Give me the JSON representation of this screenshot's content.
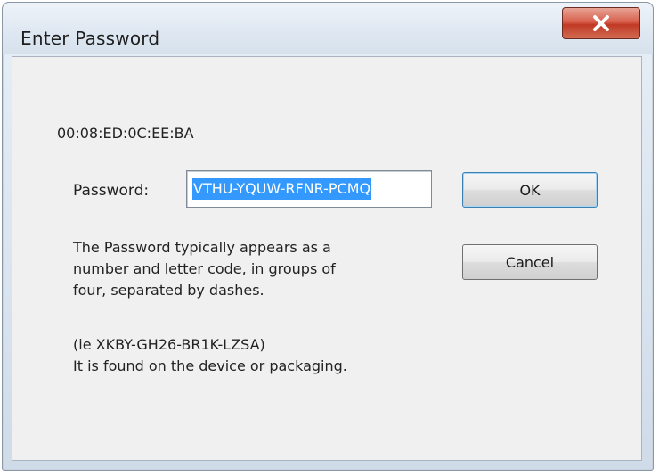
{
  "window": {
    "title": "Enter Password"
  },
  "dialog": {
    "mac_address": "00:08:ED:0C:EE:BA",
    "password_label": "Password:",
    "password_value": "VTHU-YQUW-RFNR-PCMQ",
    "ok_label": "OK",
    "cancel_label": "Cancel",
    "help_lines": [
      "The Password typically appears as a",
      "number and letter code, in groups of",
      "four, separated by dashes."
    ],
    "example_line": "(ie XKBY-GH26-BR1K-LZSA)",
    "location_line": "It is found on the device or packaging."
  },
  "colors": {
    "selection": "#3399ff",
    "close_button": "#c8432d"
  },
  "icons": {
    "close": "close-icon"
  }
}
